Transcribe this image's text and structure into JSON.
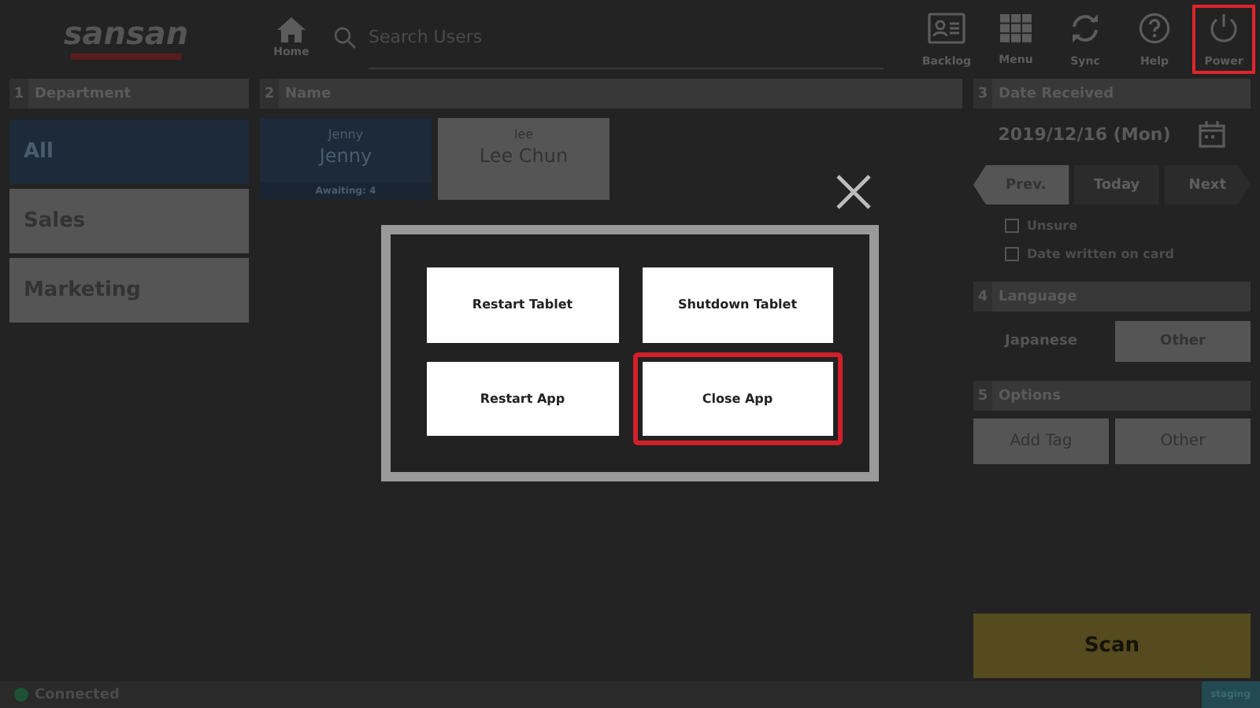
{
  "header": {
    "logo": "sansan",
    "home": {
      "label": "Home"
    },
    "search": {
      "placeholder": "Search Users"
    },
    "tools": [
      {
        "label": "Backlog",
        "kind": "card",
        "highlighted": false
      },
      {
        "label": "Menu",
        "kind": "grid",
        "highlighted": false
      },
      {
        "label": "Sync",
        "kind": "sync",
        "highlighted": false
      },
      {
        "label": "Help",
        "kind": "help",
        "highlighted": false
      },
      {
        "label": "Power",
        "kind": "power",
        "highlighted": true
      }
    ]
  },
  "department": {
    "number": "1",
    "title": "Department",
    "items": [
      {
        "label": "All",
        "selected": true
      },
      {
        "label": "Sales",
        "selected": false
      },
      {
        "label": "Marketing",
        "selected": false
      }
    ]
  },
  "names": {
    "number": "2",
    "title": "Name",
    "cards": [
      {
        "subtitle": "Jenny",
        "name": "Jenny",
        "note": "Awaiting: 4",
        "selected": true
      },
      {
        "subtitle": "lee",
        "name": "Lee Chun",
        "selected": false
      }
    ]
  },
  "date_received": {
    "number": "3",
    "title": "Date Received",
    "value": "2019/12/16 (Mon)",
    "nav": [
      {
        "label": "Prev.",
        "kind": "prev",
        "disabled": false
      },
      {
        "label": "Today",
        "kind": "today",
        "disabled": true
      },
      {
        "label": "Next",
        "kind": "next",
        "disabled": true
      }
    ],
    "checkboxes": [
      {
        "label": "Unsure",
        "checked": false
      },
      {
        "label": "Date written on card",
        "checked": false
      }
    ]
  },
  "language": {
    "number": "4",
    "title": "Language",
    "options": [
      {
        "label": "Japanese",
        "selected": true
      },
      {
        "label": "Other",
        "selected": false
      }
    ]
  },
  "options": {
    "number": "5",
    "title": "Options",
    "buttons": [
      "Add Tag",
      "Other"
    ]
  },
  "scan": "Scan",
  "status_bar": {
    "text": "Connected",
    "environment": "staging"
  },
  "dialog": {
    "buttons": [
      {
        "label": "Restart Tablet",
        "highlighted": false
      },
      {
        "label": "Shutdown Tablet",
        "highlighted": false
      },
      {
        "label": "Restart App",
        "highlighted": false
      },
      {
        "label": "Close App",
        "highlighted": true
      }
    ]
  }
}
